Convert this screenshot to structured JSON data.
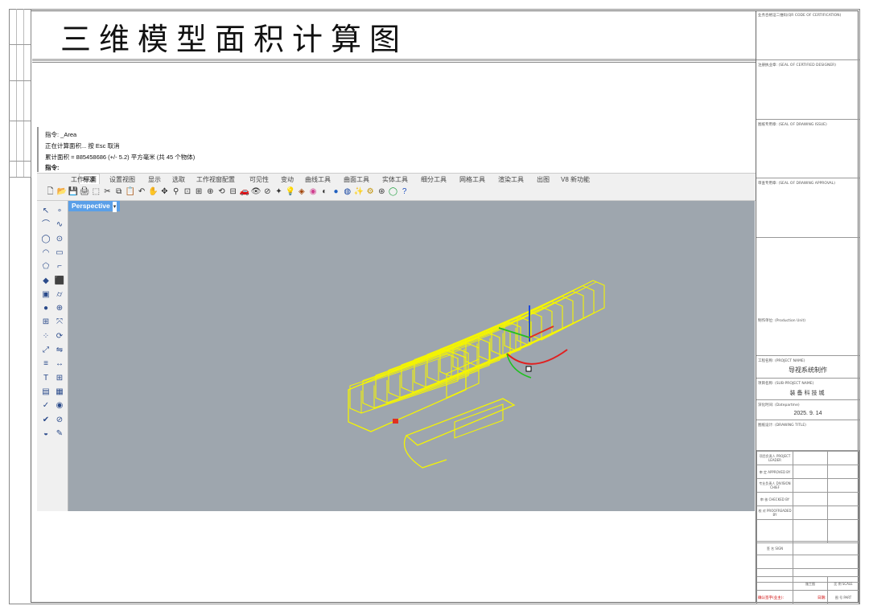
{
  "drawing_title": "三维模型面积计算图",
  "command_lines": {
    "line1": "指令: _Area",
    "line2": "正在计算面积... 按 Esc 取消",
    "line3": "累计面积 = 885458686 (+/- 5.2) 平方毫米 (共 45 个物体)",
    "line4": "指令:"
  },
  "menu_tabs": [
    "标准",
    "工作平面",
    "设置视图",
    "显示",
    "选取",
    "工作视窗配置",
    "可见性",
    "变动",
    "曲线工具",
    "曲面工具",
    "实体工具",
    "细分工具",
    "网格工具",
    "渲染工具",
    "出图",
    "V8 新功能"
  ],
  "toolbar_icons": [
    "new-file-icon",
    "open-icon",
    "save-icon",
    "print-icon",
    "import-icon",
    "cut-icon",
    "copy-icon",
    "paste-icon",
    "undo-icon",
    "pan-icon",
    "move-icon",
    "zoom-icon",
    "zoom-window-icon",
    "zoom-extents-icon",
    "zoom-selected-icon",
    "rotate-view-icon",
    "viewports-icon",
    "car-icon",
    "eye-icon",
    "cplane-icon",
    "point-icon",
    "light-icon",
    "material-icon",
    "color-wheel-icon",
    "display-icon",
    "render-icon",
    "sphere-icon",
    "wand-icon",
    "gear-icon",
    "plugin-icon",
    "globe-icon",
    "help-icon"
  ],
  "viewport": {
    "label": "Perspective",
    "background": "#9ea6ae",
    "object_color": "#f5f500"
  },
  "title_block": {
    "qr_label": "业务合格证二维码(QR CODE OF CERTIFICATION)",
    "seal_designer": "注册执业章: (SEAL OF CERTIFIED DESIGNER)",
    "seal_issue": "图纸专用章: (SEAL OF DRAWING ISSUE)",
    "seal_approval": "审查专用章: (SEAL OF DRAWING APPROVAL)",
    "production_unit": "制作单位: (Production Unit)",
    "project_name_label": "工程名称: (PROJECT NAME)",
    "project_name": "导视系统制作",
    "sub_project_label": "项目名称: (SUB-PROJECT NAME)",
    "sub_project": "装备科技城",
    "date_label": "深化时间: (Datepartme)",
    "date": "2025. 9. 14",
    "drawing_title_label": "图纸设计: (DRAWING TITLE)",
    "rows": [
      "项目负责人 PROJECT LEADER",
      "审 定 APPROVED BY",
      "专业负责人 DIVISION CHIEF",
      "审 核 CHECKED BY",
      "校 对 PROOFREADED BY"
    ],
    "drawn": "签 名 SIGN",
    "stage": "施工图",
    "scale_label": "比 例 SCALE",
    "part_label": "图 号 PART",
    "confirm_sign": "确认签字(业主):",
    "date_short": "日期:"
  }
}
